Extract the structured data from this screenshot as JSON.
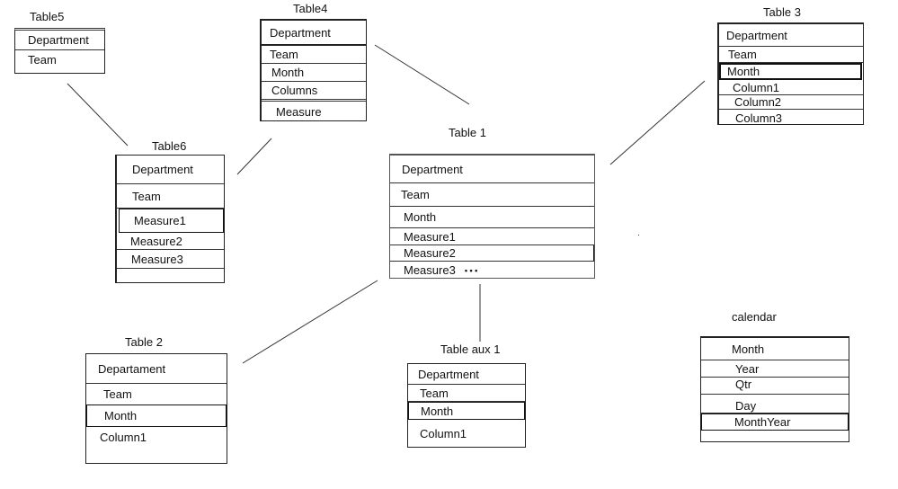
{
  "tables": {
    "table5": {
      "title": "Table5",
      "rows": [
        "Department",
        "Team"
      ]
    },
    "table4": {
      "title": "Table4",
      "rows": [
        "Department",
        "Team",
        "Month",
        "Columns",
        "Measure"
      ]
    },
    "table6": {
      "title": "Table6",
      "rows": [
        "Department",
        "Team",
        "Measure1",
        "Measure2",
        "Measure3",
        ""
      ]
    },
    "table1": {
      "title": "Table 1",
      "rows": [
        "Department",
        "Team",
        "Month",
        "Measure1",
        "Measure2",
        "Measure3"
      ],
      "ellipsis": "• • •"
    },
    "table3": {
      "title": "Table 3",
      "rows": [
        "Department",
        "Team",
        "Month",
        "Column1",
        "Column2",
        "Column3"
      ]
    },
    "table2": {
      "title": "Table 2",
      "rows": [
        "Departament",
        "Team",
        "Month",
        "Column1"
      ]
    },
    "tableaux1": {
      "title": "Table aux 1",
      "rows": [
        "Department",
        "Team",
        "Month",
        "Column1"
      ]
    },
    "calendar": {
      "title": "calendar",
      "rows": [
        "Month",
        "Year",
        "Qtr",
        "Day",
        "MonthYear",
        ""
      ]
    }
  }
}
